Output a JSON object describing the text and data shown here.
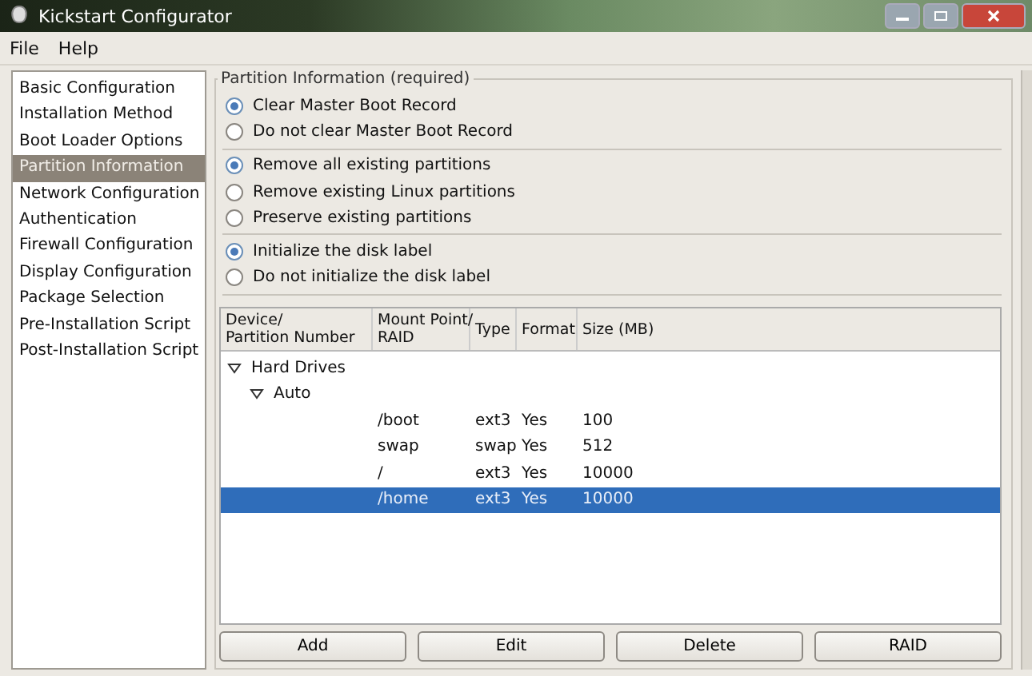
{
  "window": {
    "title": "Kickstart Configurator"
  },
  "menu": [
    "File",
    "Help"
  ],
  "sidebar": {
    "items": [
      {
        "label": "Basic Configuration",
        "selected": false
      },
      {
        "label": "Installation Method",
        "selected": false
      },
      {
        "label": "Boot Loader Options",
        "selected": false
      },
      {
        "label": "Partition Information",
        "selected": true
      },
      {
        "label": "Network Configuration",
        "selected": false
      },
      {
        "label": "Authentication",
        "selected": false
      },
      {
        "label": "Firewall Configuration",
        "selected": false
      },
      {
        "label": "Display Configuration",
        "selected": false
      },
      {
        "label": "Package Selection",
        "selected": false
      },
      {
        "label": "Pre-Installation Script",
        "selected": false
      },
      {
        "label": "Post-Installation Script",
        "selected": false
      }
    ]
  },
  "section": {
    "title": "Partition Information (required)",
    "radio_groups": [
      [
        {
          "label": "Clear Master Boot Record",
          "selected": true
        },
        {
          "label": "Do not clear Master Boot Record",
          "selected": false
        }
      ],
      [
        {
          "label": "Remove all existing partitions",
          "selected": true
        },
        {
          "label": "Remove existing Linux partitions",
          "selected": false
        },
        {
          "label": "Preserve existing partitions",
          "selected": false
        }
      ],
      [
        {
          "label": "Initialize the disk label",
          "selected": true
        },
        {
          "label": "Do not initialize the disk label",
          "selected": false
        }
      ]
    ]
  },
  "table": {
    "columns": [
      [
        "Device/",
        "Partition Number"
      ],
      [
        "Mount Point/",
        "RAID"
      ],
      [
        "Type"
      ],
      [
        "Format"
      ],
      [
        "Size (MB)"
      ]
    ],
    "rows": [
      {
        "device": "Hard Drives",
        "expanded": true,
        "children": [
          {
            "device": "Auto",
            "expanded": true,
            "children": [
              {
                "mount": "/boot",
                "type": "ext3",
                "format": "Yes",
                "size": "100",
                "selected": false
              },
              {
                "mount": "swap",
                "type": "swap",
                "format": "Yes",
                "size": "512",
                "selected": false
              },
              {
                "mount": "/",
                "type": "ext3",
                "format": "Yes",
                "size": "10000",
                "selected": false
              },
              {
                "mount": "/home",
                "type": "ext3",
                "format": "Yes",
                "size": "10000",
                "selected": true
              }
            ]
          }
        ]
      }
    ]
  },
  "buttons": [
    "Add",
    "Edit",
    "Delete",
    "RAID"
  ]
}
